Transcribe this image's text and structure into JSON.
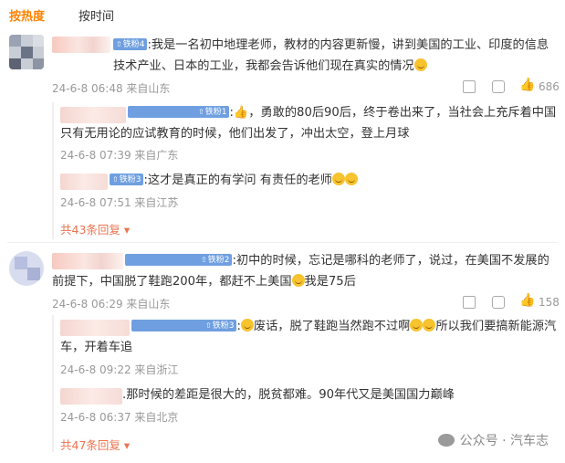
{
  "tabs": {
    "hot": "按热度",
    "time": "按时间"
  },
  "comments": [
    {
      "badge": "铁粉4",
      "text": ":我是一名初中地理老师，教材的内容更新慢，讲到美国的工业、印度的信息技术产业、日本的工业，我都会告诉他们现在真实的情况",
      "time": "24-6-8 06:48 来自山东",
      "likes": "686",
      "replies": [
        {
          "badge": "铁粉1",
          "text": ":👍，勇敢的80后90后，终于卷出来了，当社会上充斥着中国只有无用论的应试教育的时候，他们出发了，冲出太空，登上月球",
          "time": "24-6-8 07:39 来自广东"
        },
        {
          "badge": "铁粉3",
          "text": ":这才是真正的有学问 有责任的老师",
          "time": "24-6-8 07:51 来自江苏"
        }
      ],
      "more": "共43条回复"
    },
    {
      "badge": "铁粉2",
      "text": ":初中的时候，忘记是哪科的老师了，说过，在美国不发展的前提下，中国脱了鞋跑200年，都赶不上美国",
      "text_end": "我是75后",
      "time": "24-6-8 06:29 来自山东",
      "likes": "158",
      "replies": [
        {
          "badge": "铁粉3",
          "text_a": ":",
          "text_b": "废话，脱了鞋跑当然跑不过啊",
          "text_c": "所以我们要搞新能源汽车，开着车追",
          "time": "24-6-8 09:22 来自浙江"
        },
        {
          "text": ".那时候的差距是很大的，脱贫都难。90年代又是美国国力巅峰",
          "time": "24-6-8 06:37 来自北京"
        }
      ],
      "more": "共47条回复"
    }
  ],
  "watermark": "公众号 · 汽车志",
  "icons": {
    "share": "share-icon",
    "comment": "comment-icon",
    "like": "thumbs-up-icon"
  }
}
